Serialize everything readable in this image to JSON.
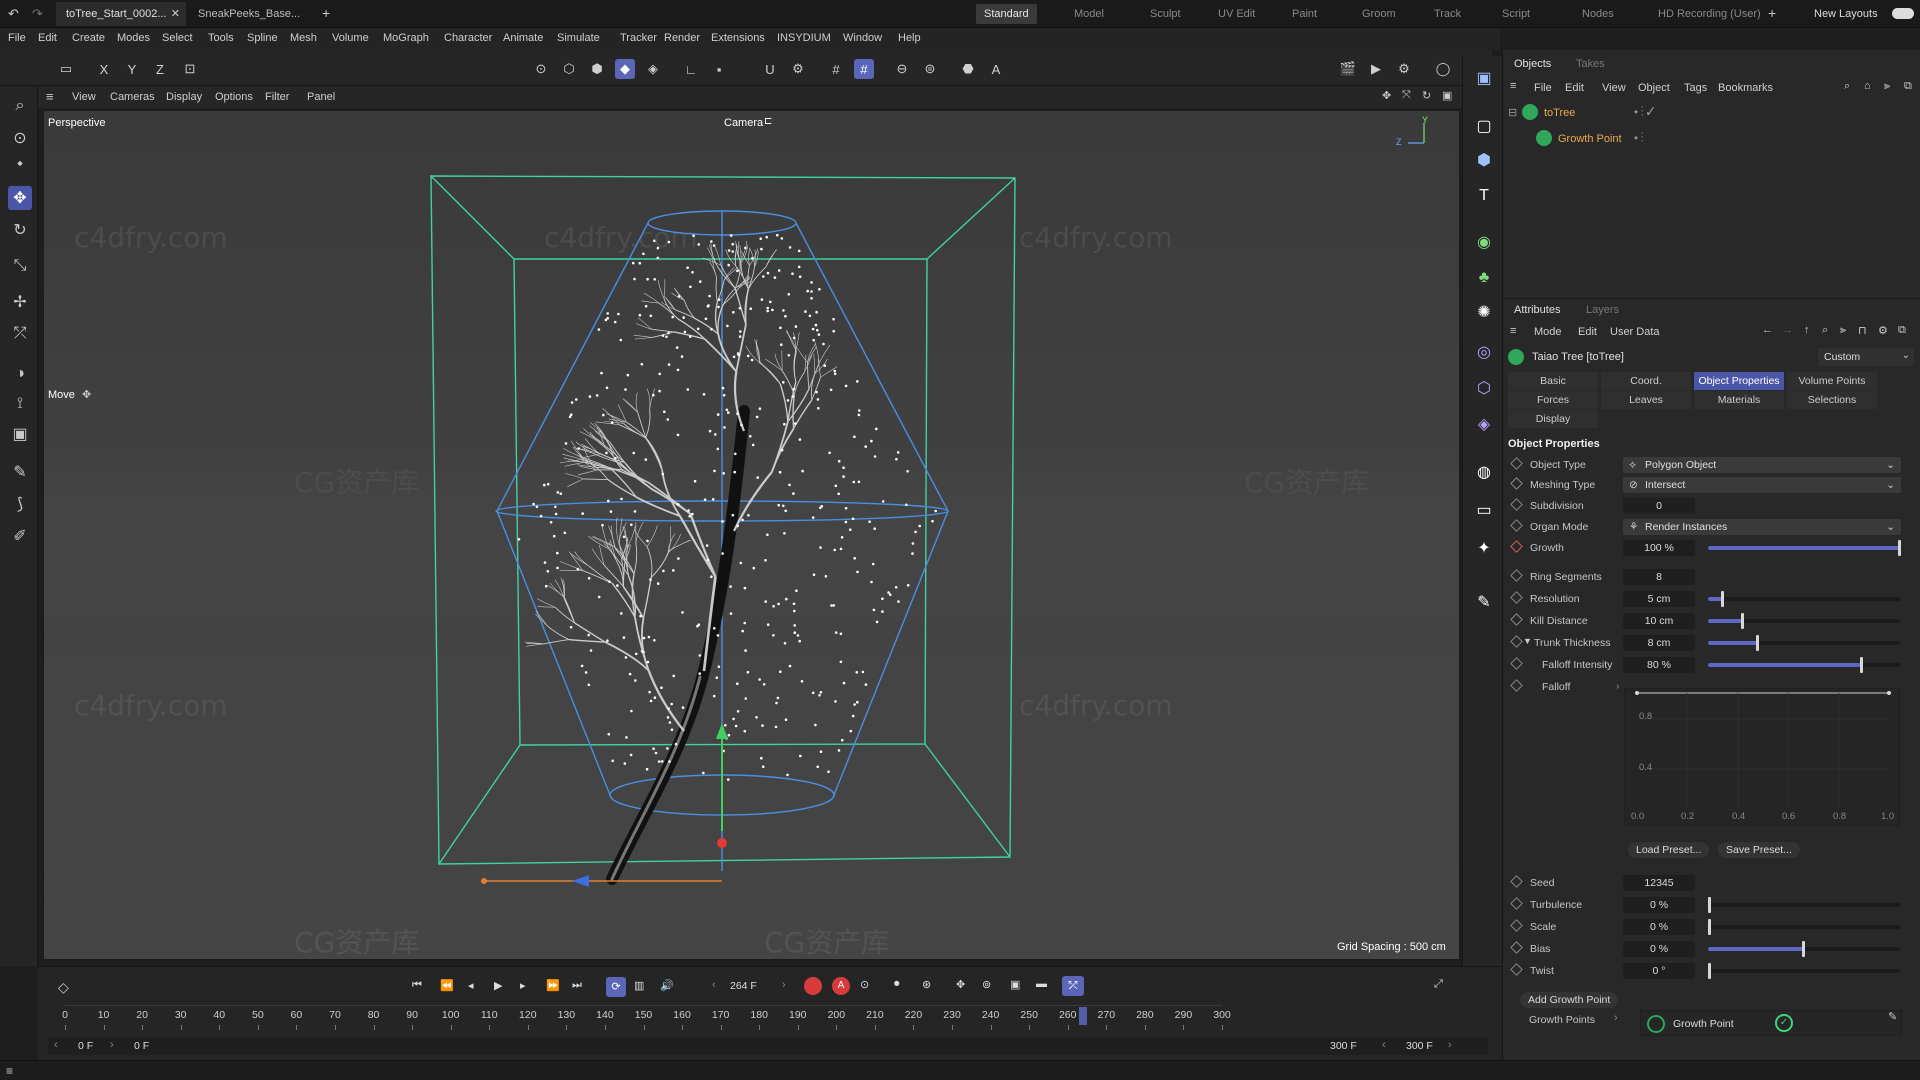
{
  "tabs": {
    "doc1": "toTree_Start_0002...",
    "doc2": "SneakPeeks_Base...",
    "layouts": [
      "Standard",
      "Model",
      "Sculpt",
      "UV Edit",
      "Paint",
      "Groom",
      "Track",
      "Script",
      "Nodes",
      "HD Recording (User)"
    ],
    "new_layouts": "New Layouts"
  },
  "menu": [
    "File",
    "Edit",
    "Create",
    "Modes",
    "Select",
    "Tools",
    "Spline",
    "Mesh",
    "Volume",
    "MoGraph",
    "Character",
    "Animate",
    "Simulate",
    "Tracker",
    "Render",
    "Extensions",
    "INSYDIUM",
    "Window",
    "Help"
  ],
  "viewport_menu": [
    "View",
    "Cameras",
    "Display",
    "Options",
    "Filter",
    "Panel"
  ],
  "viewport": {
    "name": "Perspective",
    "camera": "Camera",
    "tool": "Move",
    "grid_spacing": "Grid Spacing : 500 cm",
    "axis_y": "Y",
    "axis_z": "Z"
  },
  "watermarks": {
    "site": "c4dfry.com",
    "brand": "CG资产库"
  },
  "objects_panel": {
    "tabs": [
      "Objects",
      "Takes"
    ],
    "menu": [
      "File",
      "Edit",
      "View",
      "Object",
      "Tags",
      "Bookmarks"
    ],
    "items": [
      {
        "name": "toTree",
        "color": "#e8a94c"
      },
      {
        "name": "Growth Point",
        "color": "#e8a94c"
      }
    ]
  },
  "attributes": {
    "tabs": [
      "Attributes",
      "Layers"
    ],
    "menu": [
      "Mode",
      "Edit",
      "User Data"
    ],
    "object_title": "Taiao Tree [toTree]",
    "preset": "Custom",
    "subtabs": [
      "Basic",
      "Coord.",
      "Object Properties",
      "Volume Points",
      "Forces",
      "Leaves",
      "Materials",
      "Selections",
      "Display"
    ],
    "active_subtab": "Object Properties",
    "section": "Object Properties",
    "object_type": {
      "label": "Object Type",
      "value": "Polygon Object"
    },
    "meshing_type": {
      "label": "Meshing Type",
      "value": "Intersect"
    },
    "subdivision": {
      "label": "Subdivision",
      "value": "0"
    },
    "organ_mode": {
      "label": "Organ Mode",
      "value": "Render Instances"
    },
    "growth": {
      "label": "Growth",
      "value": "100 %",
      "level": 1.0
    },
    "ring_segments": {
      "label": "Ring Segments",
      "value": "8"
    },
    "resolution": {
      "label": "Resolution",
      "value": "5 cm",
      "level": 0.08
    },
    "kill_distance": {
      "label": "Kill Distance",
      "value": "10 cm",
      "level": 0.18
    },
    "trunk_thickness": {
      "label": "Trunk Thickness",
      "value": "8 cm",
      "level": 0.26
    },
    "falloff_intensity": {
      "label": "Falloff Intensity",
      "value": "80 %",
      "level": 0.8
    },
    "falloff": {
      "label": "Falloff"
    },
    "curve_y_ticks": [
      "0.8",
      "0.4"
    ],
    "curve_x_ticks": [
      "0.0",
      "0.2",
      "0.4",
      "0.6",
      "0.8",
      "1.0"
    ],
    "load_preset": "Load Preset...",
    "save_preset": "Save Preset...",
    "seed": {
      "label": "Seed",
      "value": "12345"
    },
    "turbulence": {
      "label": "Turbulence",
      "value": "0 %"
    },
    "scale": {
      "label": "Scale",
      "value": "0 %"
    },
    "bias": {
      "label": "Bias",
      "value": "0 %",
      "level": 0.5
    },
    "twist": {
      "label": "Twist",
      "value": "0 °"
    },
    "add_growth_point": "Add Growth Point",
    "growth_points_label": "Growth Points",
    "growth_point_item": "Growth Point"
  },
  "timeline": {
    "current_frame": "264 F",
    "ticks": [
      "0",
      "10",
      "20",
      "30",
      "40",
      "50",
      "60",
      "70",
      "80",
      "90",
      "100",
      "110",
      "120",
      "130",
      "140",
      "150",
      "160",
      "170",
      "180",
      "190",
      "200",
      "210",
      "220",
      "230",
      "240",
      "250",
      "260",
      "270",
      "280",
      "290",
      "300"
    ],
    "playhead": 264,
    "max": 300,
    "start_field": "0 F",
    "range_start": "0 F",
    "range_end": "300 F",
    "end_field": "300 F"
  },
  "colors": {
    "accent": "#5b66b8",
    "bbox_green": "#3fd3a0",
    "cage_blue": "#4a8fe0",
    "object_orange": "#e8a94c"
  }
}
